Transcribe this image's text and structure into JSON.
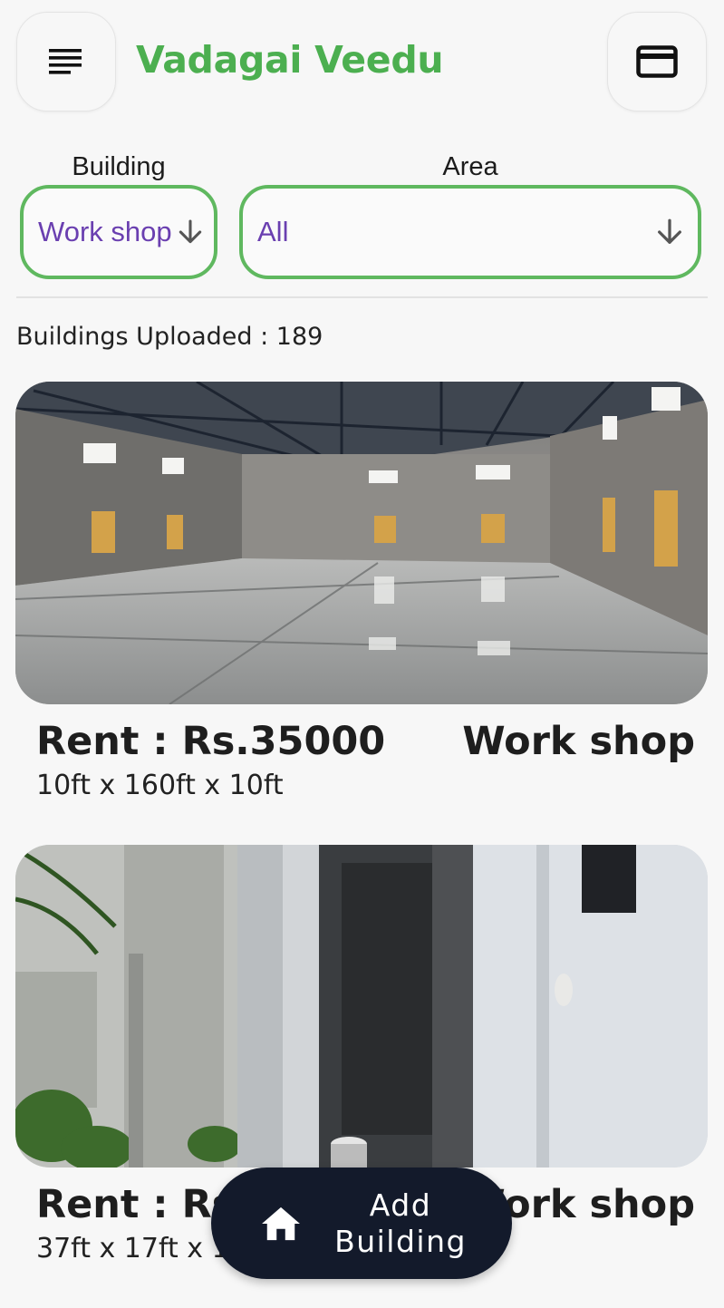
{
  "header": {
    "title": "Vadagai Veedu",
    "menu_icon": "menu-lines-icon",
    "card_icon": "credit-card-icon"
  },
  "filters": {
    "building_label": "Building",
    "building_value": "Work shop",
    "area_label": "Area",
    "area_value": "All"
  },
  "summary": {
    "count_text": "Buildings Uploaded : 189"
  },
  "listings": [
    {
      "rent": "Rent : Rs.35000",
      "type": "Work shop",
      "dimensions": "10ft x 160ft x 10ft"
    },
    {
      "rent": "Rent : Rs",
      "type": "Work shop",
      "dimensions": "37ft x 17ft x 1"
    }
  ],
  "fab": {
    "line1": "Add",
    "line2": "Building",
    "icon": "home-icon"
  },
  "colors": {
    "brand_green": "#4caf50",
    "dropdown_border": "#5fb85f",
    "dropdown_text": "#6a3fb0",
    "fab_bg": "#131a2b"
  }
}
